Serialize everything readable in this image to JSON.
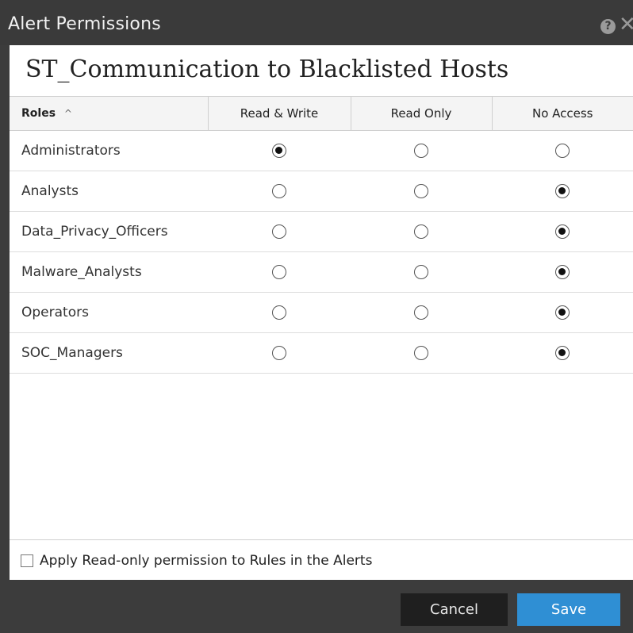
{
  "window": {
    "title": "Alert Permissions",
    "help_icon": "question-circle-icon",
    "help_glyph": "?",
    "close_icon": "close-icon",
    "close_glyph": "✕"
  },
  "rule_name": "ST_Communication to Blacklisted Hosts",
  "table": {
    "columns": [
      "Roles",
      "Read & Write",
      "Read Only",
      "No Access"
    ],
    "sort_icon": "chevron-up-icon",
    "sort_glyph": "^",
    "rows": [
      {
        "role": "Administrators",
        "selected": "Read & Write"
      },
      {
        "role": "Analysts",
        "selected": "No Access"
      },
      {
        "role": "Data_Privacy_Officers",
        "selected": "No Access"
      },
      {
        "role": "Malware_Analysts",
        "selected": "No Access"
      },
      {
        "role": "Operators",
        "selected": "No Access"
      },
      {
        "role": "SOC_Managers",
        "selected": "No Access"
      }
    ]
  },
  "apply_checkbox": {
    "label": "Apply Read-only permission to Rules in the Alerts",
    "checked": false
  },
  "buttons": {
    "cancel": "Cancel",
    "save": "Save"
  },
  "colors": {
    "title_bar": "#3a3a3a",
    "save_button": "#2f8fd4",
    "cancel_button": "#1f1f1f"
  }
}
